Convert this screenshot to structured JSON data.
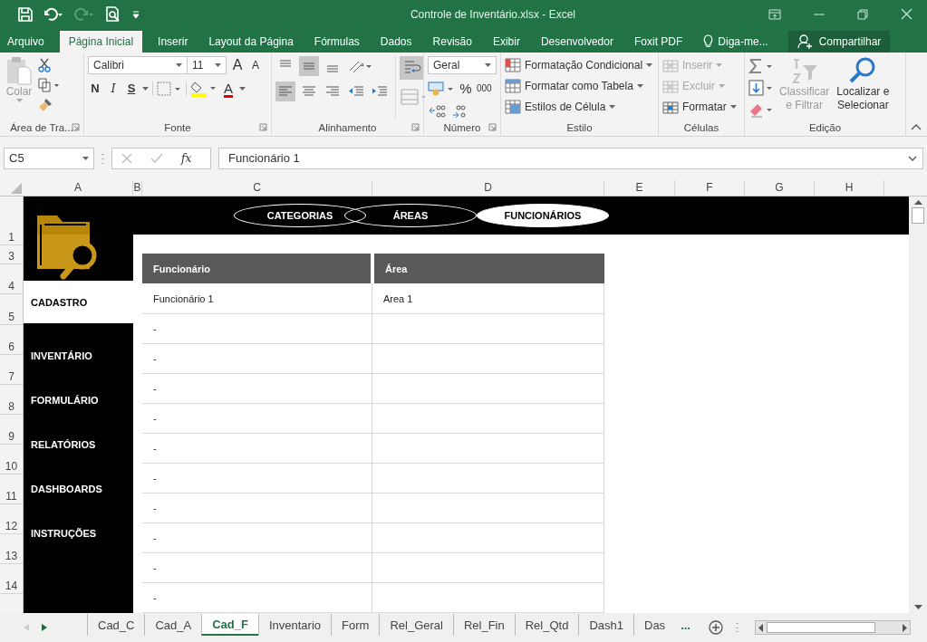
{
  "window": {
    "title": "Controle de Inventário.xlsx - Excel"
  },
  "ribbon_tabs": [
    {
      "label": "Arquivo",
      "selected": false
    },
    {
      "label": "Página Inicial",
      "selected": true
    },
    {
      "label": "Inserir",
      "selected": false
    },
    {
      "label": "Layout da Página",
      "selected": false
    },
    {
      "label": "Fórmulas",
      "selected": false
    },
    {
      "label": "Dados",
      "selected": false
    },
    {
      "label": "Revisão",
      "selected": false
    },
    {
      "label": "Exibir",
      "selected": false
    },
    {
      "label": "Desenvolvedor",
      "selected": false
    },
    {
      "label": "Foxit PDF",
      "selected": false
    }
  ],
  "tell_me": "Diga-me...",
  "share": "Compartilhar",
  "ribbon_groups": [
    {
      "kind": "clipboard",
      "label": "Área de Tra...",
      "launcher": true,
      "paste": "Colar"
    },
    {
      "kind": "font",
      "label": "Fonte",
      "launcher": true,
      "font_name": "Calibri",
      "font_size": "11",
      "grow": "A",
      "shrink": "A",
      "bold": "N",
      "italic": "I",
      "underline": "S",
      "font_color": "A"
    },
    {
      "kind": "alignment",
      "label": "Alinhamento",
      "launcher": true,
      "vertical_align": [
        {
          "selected": false
        },
        {
          "selected": true
        },
        {
          "selected": false
        }
      ],
      "horizontal_align": [
        {
          "selected": true
        },
        {
          "selected": false
        },
        {
          "selected": false
        }
      ],
      "wrap_text": {
        "selected": true
      }
    },
    {
      "kind": "number",
      "label": "Número",
      "launcher": true,
      "format": "Geral",
      "percent": "%",
      "thousands": "000"
    },
    {
      "kind": "style",
      "label": "Estilo",
      "launcher": false,
      "commands": [
        "Formatação Condicional",
        "Formatar como Tabela",
        "Estilos de Célula"
      ]
    },
    {
      "kind": "cells",
      "label": "Células",
      "launcher": false,
      "commands": [
        {
          "label": "Inserir",
          "disabled": true
        },
        {
          "label": "Excluir",
          "disabled": true
        },
        {
          "label": "Formatar",
          "disabled": false
        }
      ]
    },
    {
      "kind": "editing",
      "label": "Edição",
      "launcher": false,
      "sort": {
        "lines": [
          "Classificar",
          "e Filtrar"
        ],
        "disabled": true
      },
      "find": {
        "lines": [
          "Localizar e",
          "Selecionar"
        ],
        "disabled": false
      }
    }
  ],
  "formula_bar": {
    "name_box": "C5",
    "function_label": "fx",
    "formula": "Funcionário 1"
  },
  "columns": [
    "A",
    "B",
    "C",
    "D",
    "E",
    "F",
    "G",
    "H"
  ],
  "rows": [
    "1",
    "3",
    "4",
    "5",
    "6",
    "7",
    "8",
    "9",
    "10",
    "11",
    "12",
    "13",
    "14"
  ],
  "nav_buttons": [
    {
      "label": "CATEGORIAS",
      "selected": false
    },
    {
      "label": "ÁREAS",
      "selected": false
    },
    {
      "label": "FUNCIONÁRIOS",
      "selected": true
    }
  ],
  "sidebar": [
    {
      "label": "CADASTRO",
      "selected": true
    },
    {
      "label": "INVENTÁRIO",
      "selected": false
    },
    {
      "label": "FORMULÁRIO",
      "selected": false
    },
    {
      "label": "RELATÓRIOS",
      "selected": false
    },
    {
      "label": "DASHBOARDS",
      "selected": false
    },
    {
      "label": "INSTRUÇÕES",
      "selected": false
    }
  ],
  "table": {
    "columns": [
      "Funcionário",
      "Área"
    ],
    "rows": [
      {
        "funcionario": "Funcionário 1",
        "area": "Area 1"
      },
      {
        "funcionario": "-"
      },
      {
        "funcionario": "-"
      },
      {
        "funcionario": "-"
      },
      {
        "funcionario": "-"
      },
      {
        "funcionario": "-"
      },
      {
        "funcionario": "-"
      },
      {
        "funcionario": "-"
      },
      {
        "funcionario": "-"
      },
      {
        "funcionario": "-"
      },
      {
        "funcionario": "-"
      }
    ]
  },
  "sheet_tabs": [
    {
      "label": "Cad_C",
      "selected": false
    },
    {
      "label": "Cad_A",
      "selected": false
    },
    {
      "label": "Cad_F",
      "selected": true
    },
    {
      "label": "Inventario",
      "selected": false
    },
    {
      "label": "Form",
      "selected": false
    },
    {
      "label": "Rel_Geral",
      "selected": false
    },
    {
      "label": "Rel_Fin",
      "selected": false
    },
    {
      "label": "Rel_Qtd",
      "selected": false
    },
    {
      "label": "Dash1",
      "selected": false
    },
    {
      "label": "Das",
      "selected": false
    }
  ],
  "more_tabs": "..."
}
